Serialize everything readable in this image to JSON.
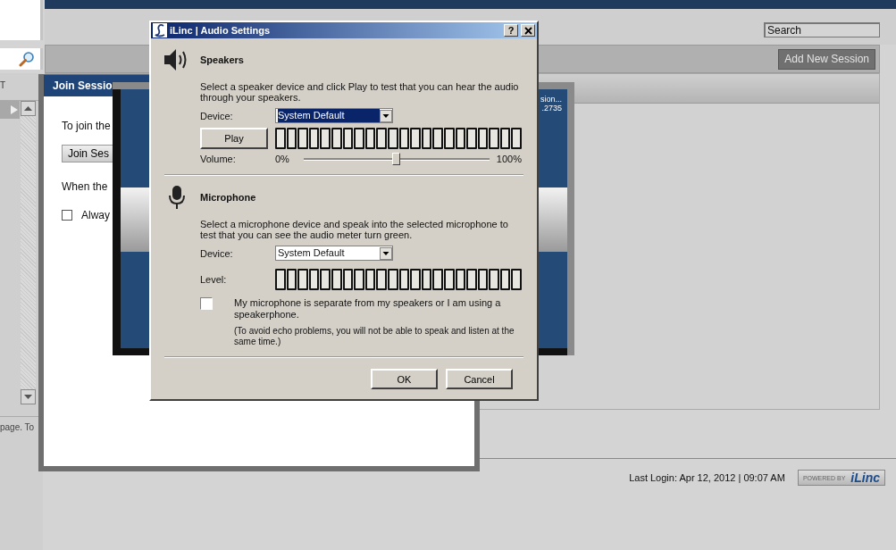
{
  "sidebar": {
    "column_header": "T",
    "footer_text": "page. To"
  },
  "header": {
    "search": {
      "placeholder": "Search"
    }
  },
  "toolbar": {
    "button": "Add New Session"
  },
  "join_dialog": {
    "title": "Join Sessio",
    "intro": "To join the",
    "button": "Join Ses",
    "note": "When the",
    "checkbox": {
      "label": "Alway",
      "checked": false
    }
  },
  "session_panel": {
    "lines": [
      "sion...",
      ".2735"
    ]
  },
  "audio_dialog": {
    "title": "iLinc | Audio Settings",
    "help_button": "?",
    "speakers": {
      "heading": "Speakers",
      "description": "Select a speaker device and click Play to test that you can hear the audio through your speakers.",
      "device_label": "Device:",
      "device_value": "System Default",
      "device_highlighted": true,
      "play_button": "Play",
      "volume_label": "Volume:",
      "volume_min": "0%",
      "volume_max": "100%",
      "volume": {
        "level": 0.5
      }
    },
    "microphone": {
      "heading": "Microphone",
      "description": "Select a microphone device and speak into the selected microphone to test that you can see the audio meter turn green.",
      "device_label": "Device:",
      "device_value": "System Default",
      "device_highlighted": false,
      "level_label": "Level:",
      "checkbox": {
        "label": "My microphone is separate from my speakers or I am using a speakerphone.",
        "checked": false
      },
      "note": "(To avoid echo problems, you will not be able to speak and listen at the same time.)"
    },
    "buttons": [
      "OK",
      "Cancel"
    ]
  },
  "footer": {
    "last_login": "Last Login: Apr 12, 2012 | 09:07 AM",
    "powered_by": "POWERED BY",
    "brand": "iLinc"
  }
}
